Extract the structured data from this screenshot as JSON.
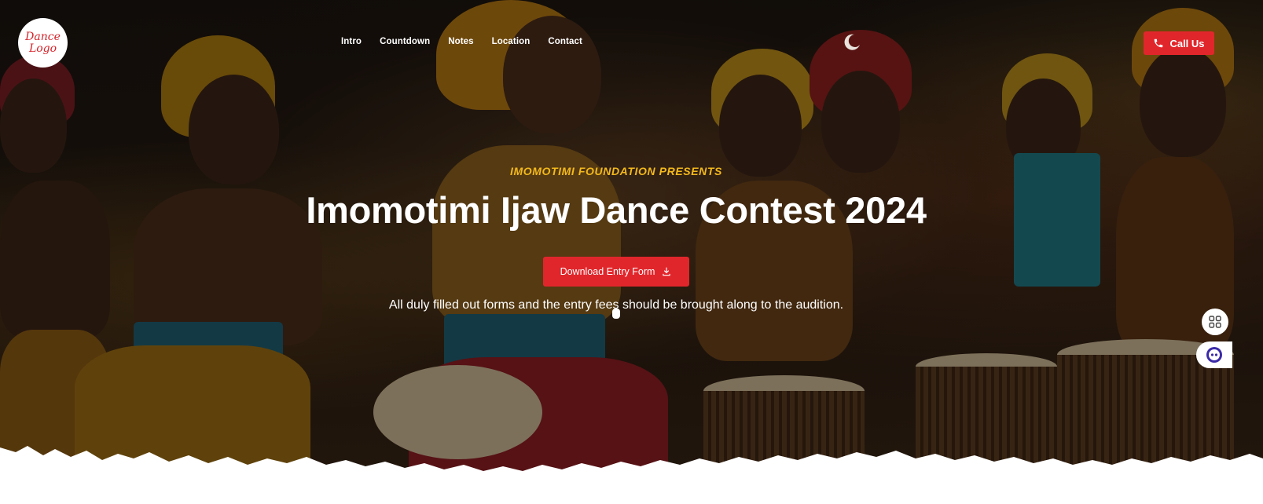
{
  "logo": {
    "line1": "Dance",
    "line2": "Logo"
  },
  "nav": {
    "items": [
      "Intro",
      "Countdown",
      "Notes",
      "Location",
      "Contact"
    ]
  },
  "theme_toggle": {
    "icon": "moon-icon"
  },
  "header": {
    "call_label": "Call Us",
    "call_icon": "phone-icon"
  },
  "hero": {
    "presenter": "IMOMOTIMI FOUNDATION PRESENTS",
    "title": "Imomotimi Ijaw Dance Contest 2024",
    "download_label": "Download Entry Form",
    "download_icon": "download-icon",
    "note": "All duly filled out forms and the entry fees should be brought along to the audition."
  },
  "side_widgets": {
    "apps_icon": "grid-icon",
    "assistant_icon": "assistant-icon"
  },
  "colors": {
    "accent": "#e1262b",
    "presenter": "#f4b91c",
    "text": "#ffffff"
  }
}
